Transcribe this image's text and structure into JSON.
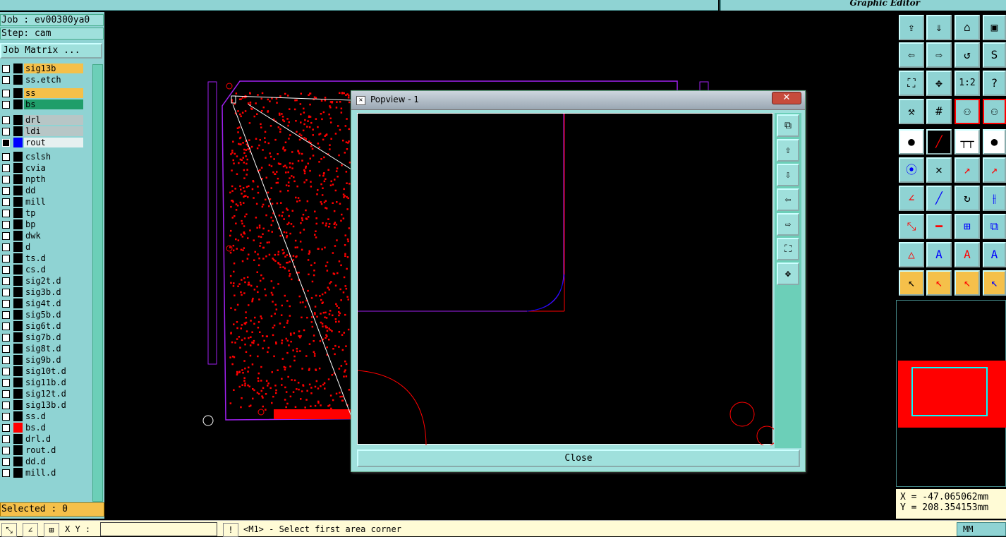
{
  "app": {
    "title": "Graphic Editor"
  },
  "left_panel": {
    "job": "Job : ev00300ya0",
    "step": "Step: cam",
    "job_matrix": "Job Matrix ...",
    "selected": "Selected : 0"
  },
  "layers": [
    {
      "name": "sig13b",
      "style": "y"
    },
    {
      "name": "ss.etch",
      "style": ""
    },
    {
      "name": "ss",
      "style": "y"
    },
    {
      "name": "bs",
      "style": "g"
    },
    {
      "name": "drl",
      "style": "gy"
    },
    {
      "name": "ldi",
      "style": "gy"
    },
    {
      "name": "rout",
      "style": "w"
    },
    {
      "name": "cslsh",
      "style": ""
    },
    {
      "name": "cvia",
      "style": ""
    },
    {
      "name": "npth",
      "style": ""
    },
    {
      "name": "dd",
      "style": ""
    },
    {
      "name": "mill",
      "style": ""
    },
    {
      "name": "tp",
      "style": ""
    },
    {
      "name": "bp",
      "style": ""
    },
    {
      "name": "dwk",
      "style": ""
    },
    {
      "name": "d",
      "style": ""
    },
    {
      "name": "ts.d",
      "style": ""
    },
    {
      "name": "cs.d",
      "style": ""
    },
    {
      "name": "sig2t.d",
      "style": ""
    },
    {
      "name": "sig3b.d",
      "style": ""
    },
    {
      "name": "sig4t.d",
      "style": ""
    },
    {
      "name": "sig5b.d",
      "style": ""
    },
    {
      "name": "sig6t.d",
      "style": ""
    },
    {
      "name": "sig7b.d",
      "style": ""
    },
    {
      "name": "sig8t.d",
      "style": ""
    },
    {
      "name": "sig9b.d",
      "style": ""
    },
    {
      "name": "sig10t.d",
      "style": ""
    },
    {
      "name": "sig11b.d",
      "style": ""
    },
    {
      "name": "sig12t.d",
      "style": ""
    },
    {
      "name": "sig13b.d",
      "style": ""
    },
    {
      "name": "ss.d",
      "style": ""
    },
    {
      "name": "bs.d",
      "style": ""
    },
    {
      "name": "drl.d",
      "style": ""
    },
    {
      "name": "rout.d",
      "style": ""
    },
    {
      "name": "dd.d",
      "style": ""
    },
    {
      "name": "mill.d",
      "style": ""
    }
  ],
  "popview": {
    "title": "Popview - 1",
    "close_label": "Close"
  },
  "status": {
    "xy_label": "X Y :",
    "xy_value": "",
    "prompt": "<M1> - Select first area corner",
    "units": "MM"
  },
  "coords": {
    "x": "X = -47.065062mm",
    "y": "Y = 208.354153mm"
  },
  "colors": {
    "panel": "#8fd3d3",
    "highlight": "#f5c04a",
    "board": "#ff0000",
    "outline": "#a020f0"
  }
}
